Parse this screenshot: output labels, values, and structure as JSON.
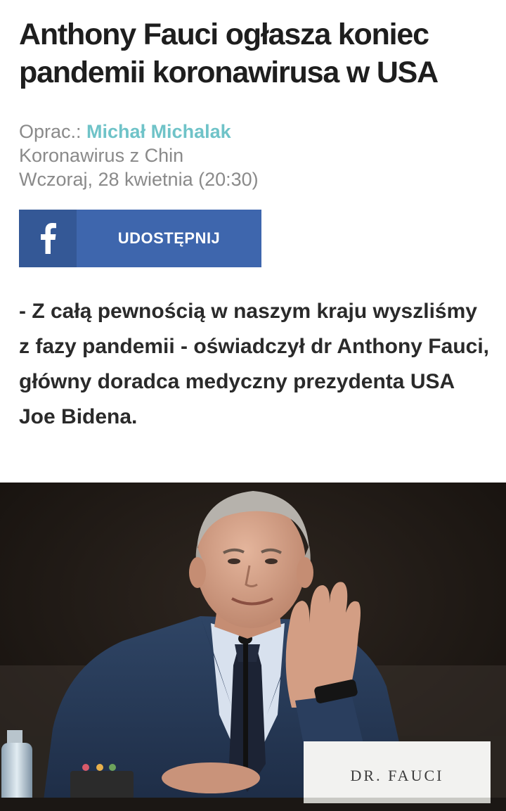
{
  "article": {
    "headline": "Anthony Fauci ogłasza koniec pandemii koronawirusa w USA",
    "byline_prefix": "Oprac.:",
    "author": "Michał Michalak",
    "category": "Koronawirus z Chin",
    "date": "Wczoraj, 28 kwietnia (20:30)",
    "lead": "- Z całą pewnością w naszym kraju wyszliśmy z fazy pandemii - oświadczył dr Anthony Fauci, główny doradca medyczny prezydenta USA Joe Bidena."
  },
  "share": {
    "label": "UDOSTĘPNIJ",
    "icon": "facebook-icon",
    "color": "#3e66ad"
  },
  "photo": {
    "nameplate": "DR. FAUCI"
  },
  "colors": {
    "accent": "#6fc3c8",
    "headline": "#1e1e1e",
    "meta": "#8a8a8a"
  }
}
